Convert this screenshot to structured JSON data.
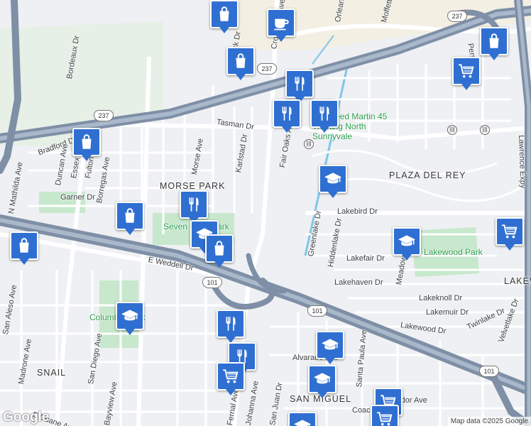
{
  "map": {
    "attribution": "Map data ©2025 Google",
    "logo_text": "Google",
    "highway_shields": [
      "237",
      "237",
      "237",
      "101",
      "101",
      "101"
    ],
    "area_labels": [
      "MORSE PARK",
      "PLAZA DEL REY",
      "SNAIL",
      "SAN MIGUEL",
      "LAKEW"
    ],
    "park_labels": [
      "Seven Seas Park",
      "Lakewood Park",
      "Columbia Park",
      "Lockheed Martin 45 Training North Sunnyvale"
    ],
    "street_labels": [
      "Bordeaux Dr",
      "Morse Ave",
      "Tasman Dr",
      "Karlstad Dr",
      "Fair Oaks Ave",
      "Crossman Ave",
      "Orleans Dr",
      "Moffett Park Dr",
      "Bradford Dr",
      "Duncan Ave",
      "Essex Av",
      "Fulton Ave",
      "Borregas Ave",
      "N Mathilda Ave",
      "Garner Dr",
      "E Weddell Dr",
      "Lakebird Dr",
      "Lakefair Dr",
      "Lakehaven Dr",
      "Lakeknoll Dr",
      "Lakemuir Dr",
      "Lakewood Dr",
      "Twinlake Dr",
      "Velvetlake Dr",
      "Greenlake Dr",
      "Hiddenlake Dr",
      "Meadowlake Dr",
      "Lawrence Expy",
      "Persian Dr",
      "San Aleso Ave",
      "Madrone Ave",
      "San Diego Ave",
      "Bayview Ave",
      "E Duane Ave",
      "Fernal Ave",
      "Johanna Ave",
      "San Juan Dr",
      "Santa Paula Ave",
      "Alvarado Ave",
      "Amador Ave",
      "Coachman Dr",
      "Hancock Dr"
    ],
    "poi_markers": [
      {
        "type": "shopping-bag"
      },
      {
        "type": "coffee"
      },
      {
        "type": "shopping-bag"
      },
      {
        "type": "restaurant"
      },
      {
        "type": "restaurant"
      },
      {
        "type": "restaurant"
      },
      {
        "type": "shopping-bag"
      },
      {
        "type": "shopping-cart"
      },
      {
        "type": "shopping-bag"
      },
      {
        "type": "school"
      },
      {
        "type": "shopping-bag"
      },
      {
        "type": "restaurant"
      },
      {
        "type": "shopping-bag"
      },
      {
        "type": "school"
      },
      {
        "type": "shopping-bag"
      },
      {
        "type": "shopping-cart"
      },
      {
        "type": "school"
      },
      {
        "type": "school"
      },
      {
        "type": "restaurant"
      },
      {
        "type": "restaurant"
      },
      {
        "type": "shopping-cart"
      },
      {
        "type": "school"
      },
      {
        "type": "school"
      },
      {
        "type": "shopping-cart"
      },
      {
        "type": "shopping-cart"
      },
      {
        "type": "school"
      }
    ]
  }
}
